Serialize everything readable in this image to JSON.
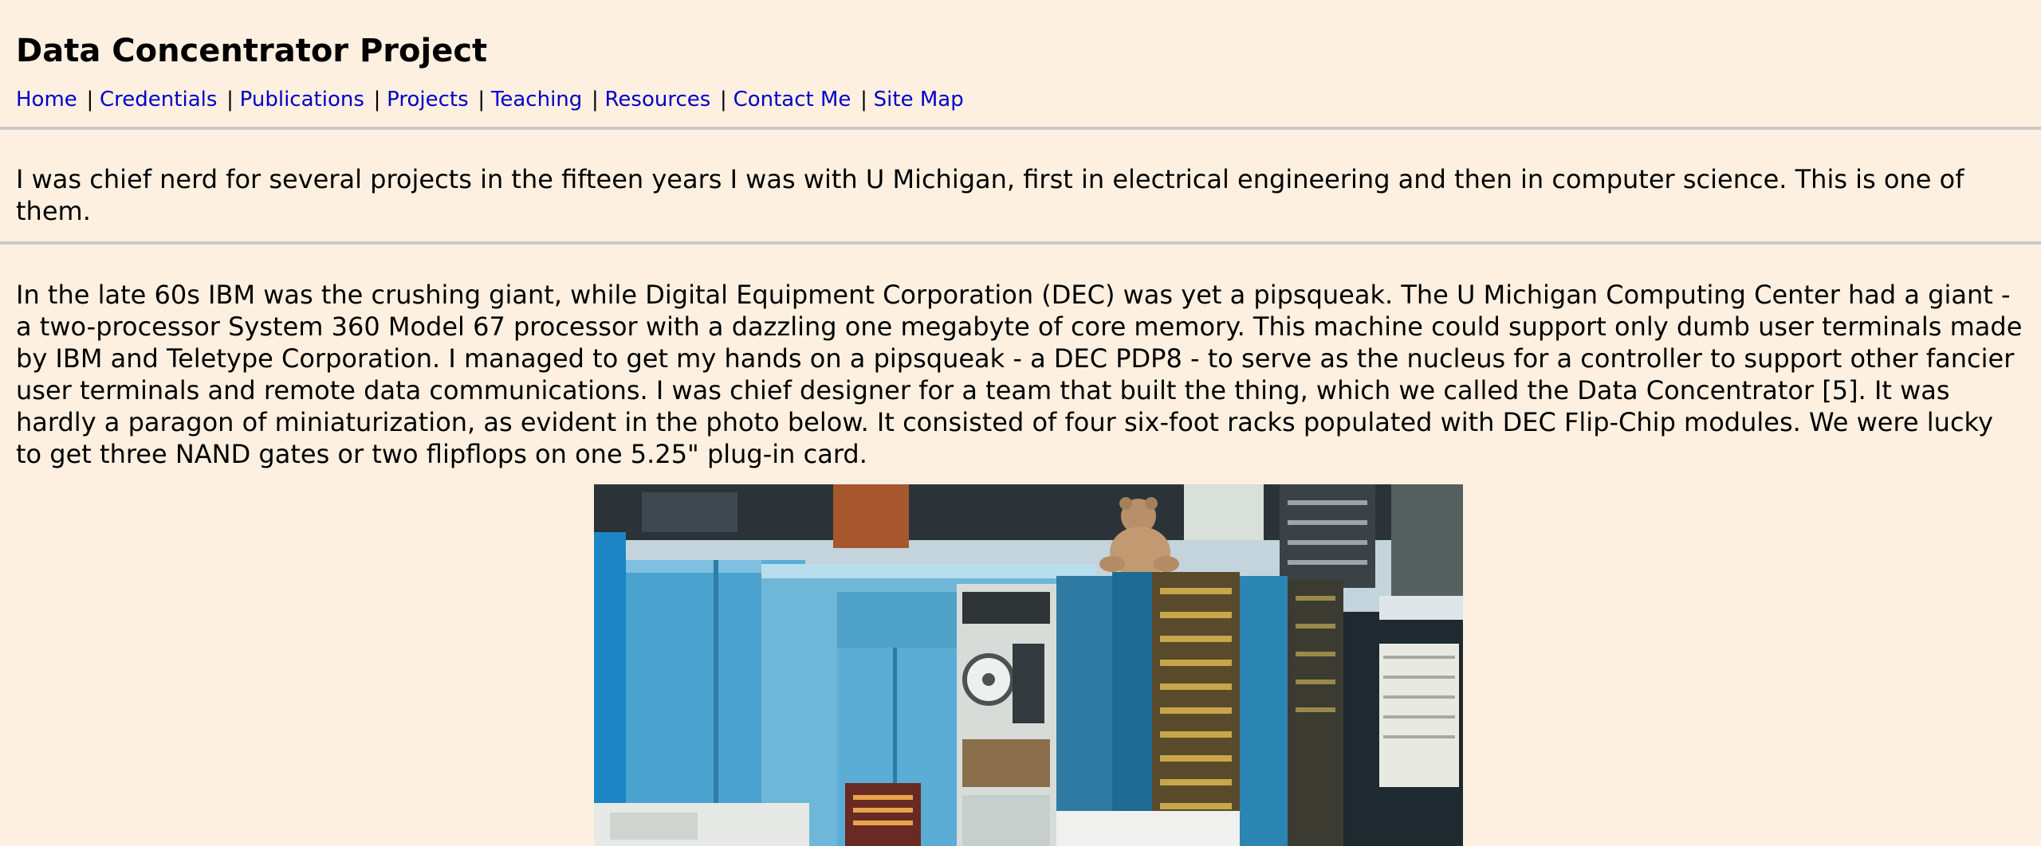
{
  "header": {
    "title": "Data Concentrator Project"
  },
  "nav": {
    "separator": "|",
    "items": [
      {
        "label": "Home"
      },
      {
        "label": "Credentials"
      },
      {
        "label": "Publications"
      },
      {
        "label": "Projects"
      },
      {
        "label": "Teaching"
      },
      {
        "label": "Resources"
      },
      {
        "label": "Contact Me"
      },
      {
        "label": "Site Map"
      }
    ]
  },
  "intro": {
    "lines": [
      "I was chief nerd for several projects in the fifteen years I was with U Michigan, first in electrical engineering and then in computer science. This is one of",
      "them."
    ]
  },
  "main": {
    "lines": [
      "In the late 60s IBM was the crushing giant, while Digital Equipment Corporation (DEC) was yet a pipsqueak. The U Michigan Computing Center had a giant -",
      "a two-processor System 360 Model 67 processor with a dazzling one megabyte of core memory. This machine could support only dumb user terminals made",
      "by IBM and Teletype Corporation. I managed to get my hands on a pipsqueak - a DEC PDP8 - to serve as the nucleus for a controller to support other fancier",
      "user terminals and remote data communications. I was chief designer for a team that built the thing, which we called the Data Concentrator [5]. It was",
      "hardly a paragon of miniaturization, as evident in the photo below. It consisted of four six-foot racks populated with DEC Flip-Chip modules. We were lucky",
      "to get three NAND gates or two flipflops on one 5.25\" plug-in card."
    ]
  },
  "colors": {
    "background": "#fdf0e0",
    "link": "#0000c8",
    "rule": "#c9c9c9"
  }
}
